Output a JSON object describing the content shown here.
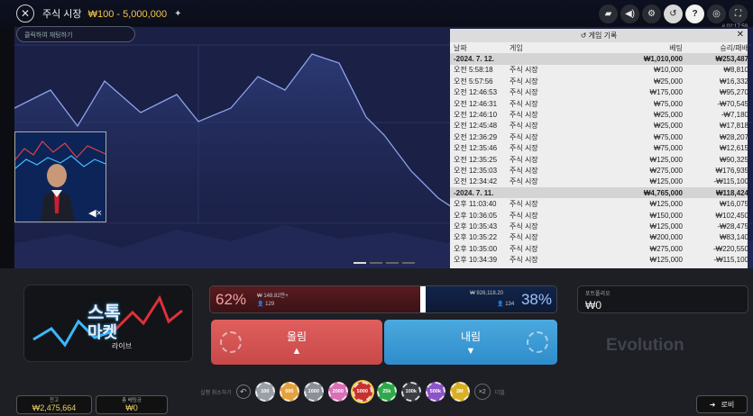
{
  "header": {
    "title": "주식 시장",
    "limits": "₩100 - 5,000,000",
    "clock": "# 02:17:59"
  },
  "chat": {
    "placeholder": "클릭하여 채팅하기"
  },
  "history": {
    "title": "게임 기록",
    "columns": [
      "날짜",
      "게임",
      "베팅",
      "승리/패배"
    ],
    "groups": [
      {
        "date": "-2024. 7. 12.",
        "bet_total": "₩1,010,000",
        "result_total": "₩253,487",
        "rows": [
          {
            "time": "오전 5:58:18",
            "game": "주식 시장",
            "bet": "₩10,000",
            "result": "₩8,810"
          },
          {
            "time": "오전 5:57:56",
            "game": "주식 시장",
            "bet": "₩25,000",
            "result": "₩16,332"
          },
          {
            "time": "오전 12:46:53",
            "game": "주식 시장",
            "bet": "₩175,000",
            "result": "₩95,270"
          },
          {
            "time": "오전 12:46:31",
            "game": "주식 시장",
            "bet": "₩75,000",
            "result": "-₩70,545"
          },
          {
            "time": "오전 12:46:10",
            "game": "주식 시장",
            "bet": "₩25,000",
            "result": "-₩7,180"
          },
          {
            "time": "오전 12:45:48",
            "game": "주식 시장",
            "bet": "₩25,000",
            "result": "₩17,818"
          },
          {
            "time": "오전 12:36:29",
            "game": "주식 시장",
            "bet": "₩75,000",
            "result": "₩28,207"
          },
          {
            "time": "오전 12:35:46",
            "game": "주식 시장",
            "bet": "₩75,000",
            "result": "₩12,615"
          },
          {
            "time": "오전 12:35:25",
            "game": "주식 시장",
            "bet": "₩125,000",
            "result": "₩90,325"
          },
          {
            "time": "오전 12:35:03",
            "game": "주식 시장",
            "bet": "₩275,000",
            "result": "₩176,935"
          },
          {
            "time": "오전 12:34:42",
            "game": "주식 시장",
            "bet": "₩125,000",
            "result": "-₩115,100"
          }
        ]
      },
      {
        "date": "-2024. 7. 11.",
        "bet_total": "₩4,765,000",
        "result_total": "₩118,424",
        "rows": [
          {
            "time": "오후 11:03:40",
            "game": "주식 시장",
            "bet": "₩125,000",
            "result": "₩16,075"
          },
          {
            "time": "오후 10:36:05",
            "game": "주식 시장",
            "bet": "₩150,000",
            "result": "₩102,450"
          },
          {
            "time": "오후 10:35:43",
            "game": "주식 시장",
            "bet": "₩125,000",
            "result": "-₩28,475"
          },
          {
            "time": "오후 10:35:22",
            "game": "주식 시장",
            "bet": "₩200,000",
            "result": "₩83,140"
          },
          {
            "time": "오후 10:35:00",
            "game": "주식 시장",
            "bet": "₩275,000",
            "result": "-₩220,550"
          },
          {
            "time": "오후 10:34:39",
            "game": "주식 시장",
            "bet": "₩125,000",
            "result": "-₩115,100"
          }
        ]
      }
    ]
  },
  "logo": {
    "line1": "스톡",
    "line2": "마켓",
    "line3": "라이브"
  },
  "ratio": {
    "up_pct": "62%",
    "up_amount": "₩ 148.82만+",
    "up_players": "129",
    "down_pct": "38%",
    "down_amount": "₩ 926,118.20",
    "down_players": "134",
    "up_fraction": 0.62
  },
  "buttons": {
    "up_label": "올림",
    "down_label": "내림"
  },
  "portfolio": {
    "label": "포트폴리오",
    "value": "₩0"
  },
  "brand": "Evolution",
  "chips": {
    "undo_label": "실행 취소하기",
    "double_label": "×2",
    "double_text": "더블",
    "items": [
      {
        "label": "100",
        "color": "#9aa0a8"
      },
      {
        "label": "500",
        "color": "#e3a23f"
      },
      {
        "label": "1000",
        "color": "#8a8f98"
      },
      {
        "label": "2000",
        "color": "#d96fb6"
      },
      {
        "label": "5000",
        "color": "#c8302e"
      },
      {
        "label": "25k",
        "color": "#2fa84a"
      },
      {
        "label": "100k",
        "color": "#3b3d44"
      },
      {
        "label": "500k",
        "color": "#8c54c8"
      },
      {
        "label": "2M",
        "color": "#d8b028"
      }
    ],
    "selected": "5000"
  },
  "balance": {
    "label": "잔고",
    "value": "₩2,475,664"
  },
  "total_bet": {
    "label": "총 베팅금",
    "value": "₩0"
  },
  "lobby": {
    "label": "로비"
  }
}
